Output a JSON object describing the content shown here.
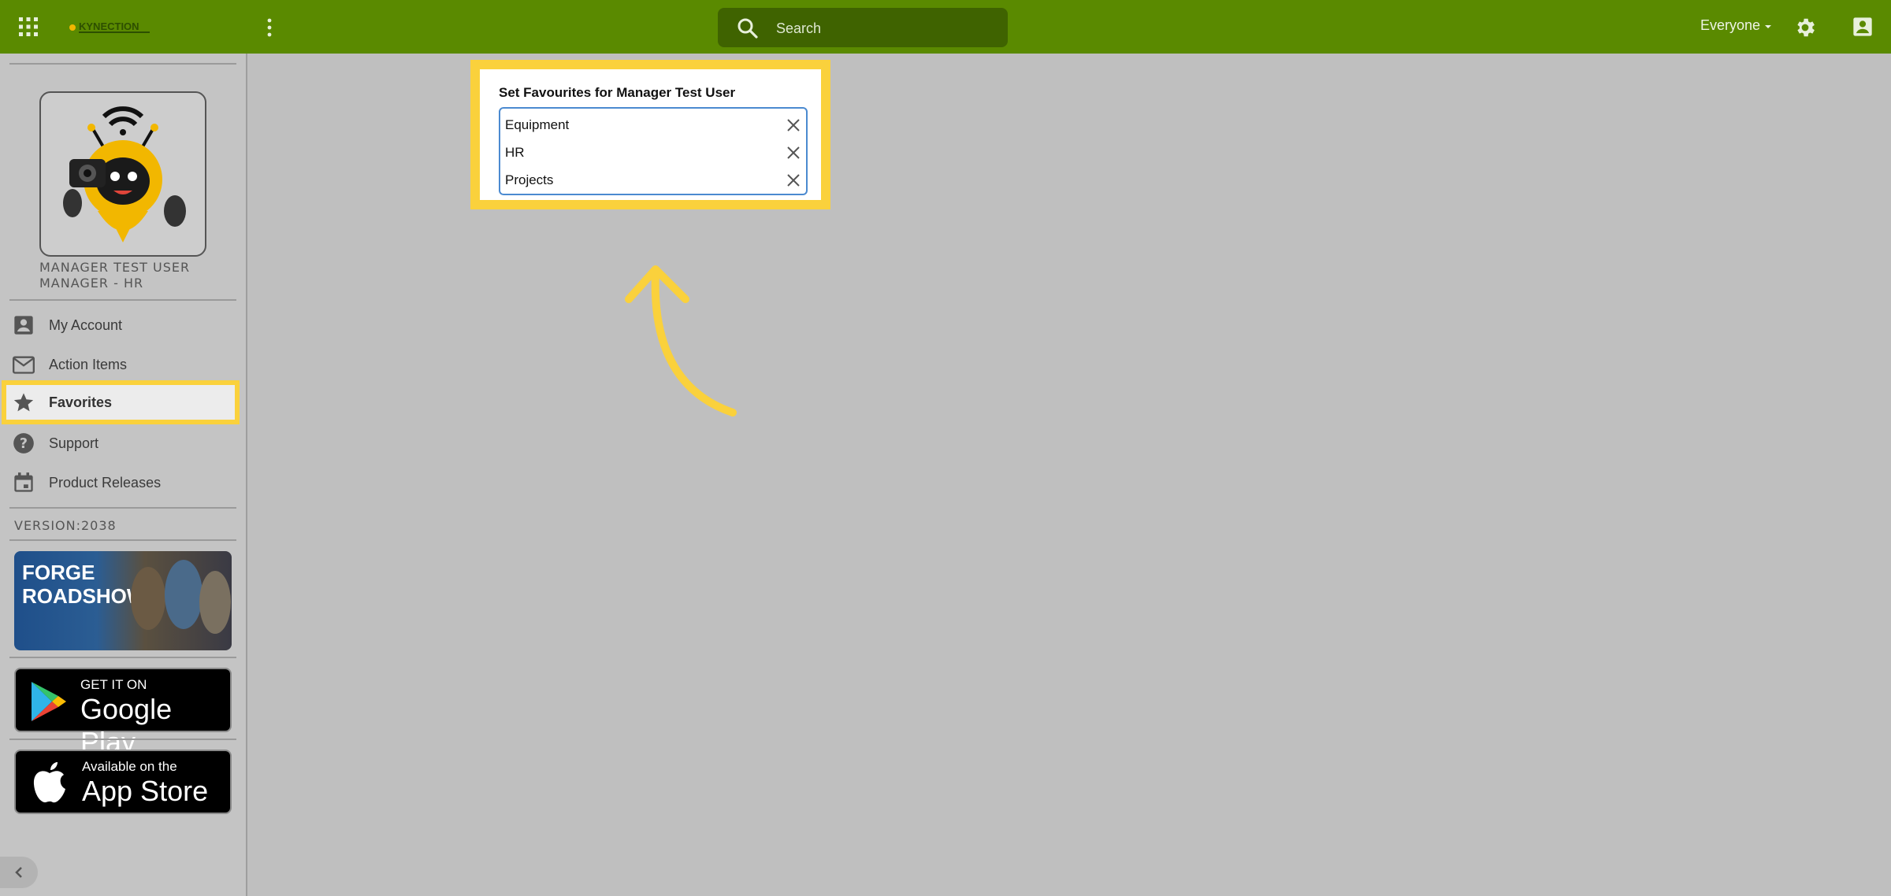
{
  "header": {
    "search_placeholder": "Search",
    "audience_label": "Everyone",
    "logo_text": "KYNECTION"
  },
  "sidebar": {
    "user_name": "MANAGER TEST USER",
    "user_role": "MANAGER - HR",
    "items": [
      {
        "label": "My Account",
        "icon": "account-box-icon"
      },
      {
        "label": "Action Items",
        "icon": "mail-icon"
      },
      {
        "label": "Favorites",
        "icon": "star-icon"
      },
      {
        "label": "Support",
        "icon": "help-icon"
      },
      {
        "label": "Product Releases",
        "icon": "calendar-icon"
      }
    ],
    "active_item": "Favorites",
    "version": "VERSION:2038",
    "promo": {
      "title_line1": "FORGE",
      "title_line2": "ROADSHOW"
    },
    "google_play": {
      "small": "GET IT ON",
      "big": "Google Play"
    },
    "app_store": {
      "small": "Available on the",
      "big": "App Store"
    }
  },
  "favourites_panel": {
    "title": "Set Favourites for Manager Test User",
    "items": [
      "Equipment",
      "HR",
      "Projects"
    ]
  },
  "colors": {
    "topbar": "#5a8a00",
    "highlight": "#fad13c",
    "background": "#bfbfbf"
  }
}
